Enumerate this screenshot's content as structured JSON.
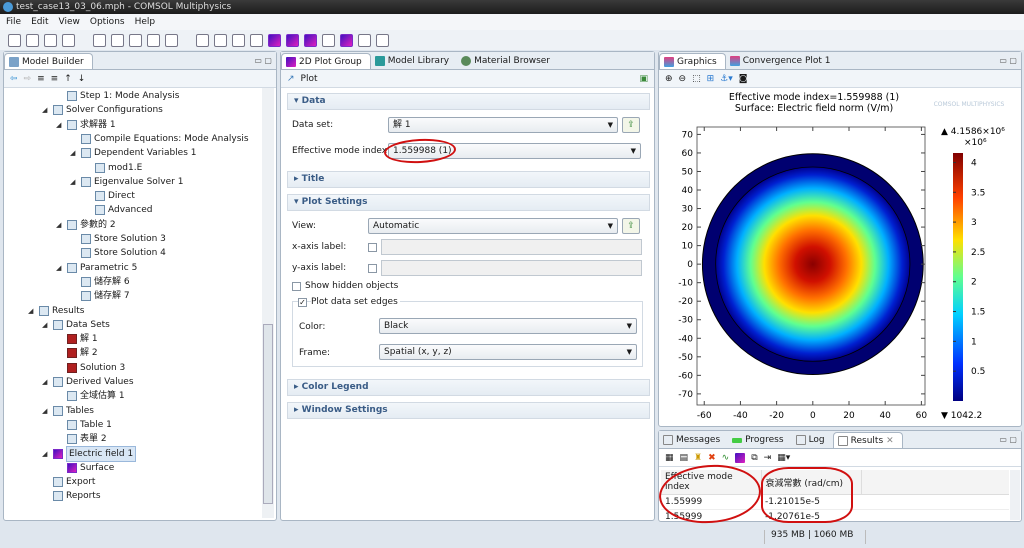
{
  "window": {
    "title": "test_case13_03_06.mph - COMSOL Multiphysics"
  },
  "menu": [
    "File",
    "Edit",
    "View",
    "Options",
    "Help"
  ],
  "model_builder": {
    "tab": "Model Builder",
    "tree": [
      {
        "label": "Step 1: Mode Analysis",
        "level": 3,
        "expanded": null
      },
      {
        "label": "Solver Configurations",
        "level": 2,
        "expanded": true
      },
      {
        "label": "求解器 1",
        "level": 3,
        "expanded": true
      },
      {
        "label": "Compile Equations: Mode Analysis",
        "level": 4,
        "expanded": null
      },
      {
        "label": "Dependent Variables 1",
        "level": 4,
        "expanded": true
      },
      {
        "label": "mod1.E",
        "level": 5,
        "expanded": null
      },
      {
        "label": "Eigenvalue Solver 1",
        "level": 4,
        "expanded": true
      },
      {
        "label": "Direct",
        "level": 5,
        "expanded": null
      },
      {
        "label": "Advanced",
        "level": 5,
        "expanded": null
      },
      {
        "label": "參數的 2",
        "level": 3,
        "expanded": true
      },
      {
        "label": "Store Solution 3",
        "level": 4,
        "expanded": null
      },
      {
        "label": "Store Solution 4",
        "level": 4,
        "expanded": null
      },
      {
        "label": "Parametric 5",
        "level": 3,
        "expanded": true
      },
      {
        "label": "儲存解 6",
        "level": 4,
        "expanded": null
      },
      {
        "label": "儲存解 7",
        "level": 4,
        "expanded": null
      },
      {
        "label": "Results",
        "level": 1,
        "expanded": true
      },
      {
        "label": "Data Sets",
        "level": 2,
        "expanded": true
      },
      {
        "label": "解 1",
        "level": 3,
        "expanded": null
      },
      {
        "label": "解 2",
        "level": 3,
        "expanded": null
      },
      {
        "label": "Solution 3",
        "level": 3,
        "expanded": null
      },
      {
        "label": "Derived Values",
        "level": 2,
        "expanded": true
      },
      {
        "label": "全域估算 1",
        "level": 3,
        "expanded": null
      },
      {
        "label": "Tables",
        "level": 2,
        "expanded": true
      },
      {
        "label": "Table 1",
        "level": 3,
        "expanded": null
      },
      {
        "label": "表單 2",
        "level": 3,
        "expanded": null
      },
      {
        "label": "Electric field 1",
        "level": 2,
        "expanded": true,
        "selected": true
      },
      {
        "label": "Surface",
        "level": 3,
        "expanded": null
      },
      {
        "label": "Export",
        "level": 2,
        "expanded": null
      },
      {
        "label": "Reports",
        "level": 2,
        "expanded": null
      }
    ]
  },
  "settings": {
    "tabs": [
      "2D Plot Group",
      "Model Library",
      "Material Browser"
    ],
    "header": "Plot",
    "data_section": "Data",
    "data_set_label": "Data set:",
    "data_set_value": "解 1",
    "mode_index_label": "Effective mode index:",
    "mode_index_value": "1.559988 (1)",
    "title_section": "Title",
    "plot_settings_section": "Plot Settings",
    "view_label": "View:",
    "view_value": "Automatic",
    "xaxis_label": "x-axis label:",
    "yaxis_label": "y-axis label:",
    "show_hidden": "Show hidden objects",
    "plot_edges": "Plot data set edges",
    "plot_edges_checked": true,
    "color_label": "Color:",
    "color_value": "Black",
    "frame_label": "Frame:",
    "frame_value": "Spatial  (x, y, z)",
    "color_legend_section": "Color Legend",
    "window_settings_section": "Window Settings"
  },
  "graphics": {
    "tabs": [
      "Graphics",
      "Convergence Plot 1"
    ],
    "title1": "Effective mode index=1.559988 (1)",
    "title2": "Surface: Electric field norm (V/m)",
    "watermark": "COMSOL MULTIPHYSICS",
    "xticks": [
      "-60",
      "-40",
      "-20",
      "0",
      "20",
      "40",
      "60"
    ],
    "yticks": [
      "70",
      "60",
      "50",
      "40",
      "30",
      "20",
      "10",
      "0",
      "-10",
      "-20",
      "-30",
      "-40",
      "-50",
      "-60",
      "-70"
    ],
    "xlim": [
      -64,
      62
    ],
    "ylim": [
      -76,
      74
    ],
    "colorbar_max": "▲ 4.1586×10⁶",
    "colorbar_scale": "×10⁶",
    "colorbar_min": "▼ 1042.2",
    "colorbar_ticks": [
      "4",
      "3.5",
      "3",
      "2.5",
      "2",
      "1.5",
      "1",
      "0.5"
    ]
  },
  "bottom": {
    "tabs": [
      "Messages",
      "Progress",
      "Log",
      "Results"
    ],
    "columns": [
      "Effective mode index",
      "衰減常數 (rad/cm)"
    ],
    "rows": [
      [
        "1.55999",
        "-1.21015e-5"
      ],
      [
        "1.55999",
        "-1.20761e-5"
      ]
    ]
  },
  "status": {
    "memory": "935 MB | 1060 MB"
  }
}
